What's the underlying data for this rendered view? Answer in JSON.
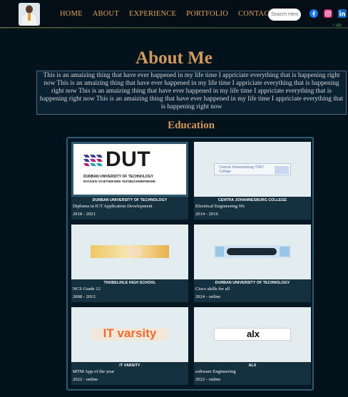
{
  "nav": {
    "items": [
      "HOME",
      "ABOUT",
      "EXPERIENCE",
      "PORTFOLIO",
      "CONTACT"
    ],
    "search_placeholder": "Search Here",
    "accent_color": "#e5a55c"
  },
  "social": [
    "facebook-icon",
    "instagram-icon",
    "linkedin-icon"
  ],
  "signature_text": "~ alx",
  "about": {
    "title": "About Me",
    "text": "This is an amaizing thing that have ever happened in my life time I appriciate everything that is happening right now This is an amaizing thing that have ever happened in my life time I appriciate everything that is happening right now This is an amaizing thing that have ever happened in my life time I appriciate everything that is happening right now This is an amaizing thing that have ever happened in my life time I appriciate everything that is happening right now"
  },
  "education": {
    "title": "Education",
    "cards": [
      {
        "school": "DURBAN UNIVERSITY OF TECHNOLOGY",
        "course": "Diploma in ICT Application Development",
        "years": "2018 - 2021",
        "logo_text": "DUT",
        "logo_sub1": "DURBAN UNIVERSITY OF TECHNOLOGY",
        "logo_sub2": "INYUVESI YASETHEKWINI YEZOBUCHWEPHESHE"
      },
      {
        "school": "CENTRA JOHANNESBURG COLLEGE",
        "course": "Electrical Engineering N6",
        "years": "2014 - 2016",
        "logo_text": "Central Johannesburg TVET College"
      },
      {
        "school": "THUBELIHLE HIGH SCHOOL",
        "course": "NCS Grade 12",
        "years": "2008 - 2012",
        "logo_text": ""
      },
      {
        "school": "DURBAN UNIVERSITY OF TECHNOLOGY",
        "course": "Cisco skills for all",
        "years": "2024 - online",
        "logo_text": ""
      },
      {
        "school": "IT VARSITY",
        "course": "MTM App of the year",
        "years": "2022 - online",
        "logo_text": "IT varsity"
      },
      {
        "school": "ALX",
        "course": "software Engineering",
        "years": "2022 - online",
        "logo_text": "alx"
      }
    ]
  },
  "colors": {
    "background": "#04121c",
    "heading": "#d09a5c",
    "panel_border": "#2f5b72"
  }
}
